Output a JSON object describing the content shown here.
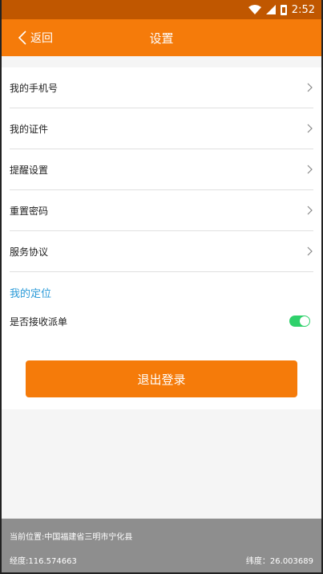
{
  "status_bar": {
    "time": "2:52"
  },
  "header": {
    "back_label": "返回",
    "title": "设置"
  },
  "menu": {
    "items": [
      {
        "label": "我的手机号"
      },
      {
        "label": "我的证件"
      },
      {
        "label": "提醒设置"
      },
      {
        "label": "重置密码"
      },
      {
        "label": "服务协议"
      }
    ]
  },
  "location": {
    "section_title": "我的定位",
    "accept_orders_label": "是否接收派单",
    "accept_orders_enabled": true
  },
  "logout_button": {
    "label": "退出登录"
  },
  "footer": {
    "address": "当前位置:中国福建省三明市宁化县",
    "longitude": "经度:116.574663",
    "latitude": "纬度：26.003689"
  },
  "colors": {
    "accent": "#f57b0a",
    "status_bar": "#c05700",
    "toggle_on": "#2fd16b",
    "section_title": "#2a9ad8",
    "footer_bg": "#8e8e8e"
  }
}
